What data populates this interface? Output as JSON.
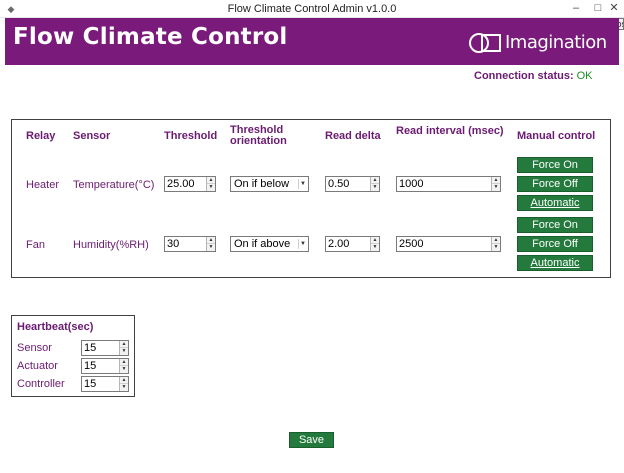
{
  "window": {
    "title": "Flow Climate Control Admin v1.0.0",
    "app_icon": "diamond-icon",
    "minimize": "–",
    "maximize": "□",
    "close": "✕",
    "tooltip": "Close"
  },
  "header": {
    "title": "Flow Climate Control",
    "logo_text": "Imagination",
    "background_color": "#7a1a7b"
  },
  "connection": {
    "label": "Connection status:",
    "value": "OK",
    "value_color": "#1e8c2a"
  },
  "table": {
    "headers": {
      "relay": "Relay",
      "sensor": "Sensor",
      "threshold": "Threshold",
      "threshold_orientation_line1": "Threshold",
      "threshold_orientation_line2": "orientation",
      "read_delta": "Read delta",
      "read_interval": "Read interval (msec)",
      "manual_control": "Manual control"
    },
    "rows": [
      {
        "relay": "Heater",
        "sensor": "Temperature(°C)",
        "threshold": "25.00",
        "orientation": "On if below",
        "read_delta": "0.50",
        "read_interval": "1000",
        "force_on": "Force On",
        "force_off": "Force Off",
        "automatic": "Automatic"
      },
      {
        "relay": "Fan",
        "sensor": "Humidity(%RH)",
        "threshold": "30",
        "orientation": "On if above",
        "read_delta": "2.00",
        "read_interval": "2500",
        "force_on": "Force On",
        "force_off": "Force Off",
        "automatic": "Automatic"
      }
    ]
  },
  "heartbeat": {
    "title": "Heartbeat(sec)",
    "items": [
      {
        "label": "Sensor",
        "value": "15"
      },
      {
        "label": "Actuator",
        "value": "15"
      },
      {
        "label": "Controller",
        "value": "15"
      }
    ]
  },
  "footer": {
    "save_label": "Save",
    "button_color": "#237a3c"
  }
}
